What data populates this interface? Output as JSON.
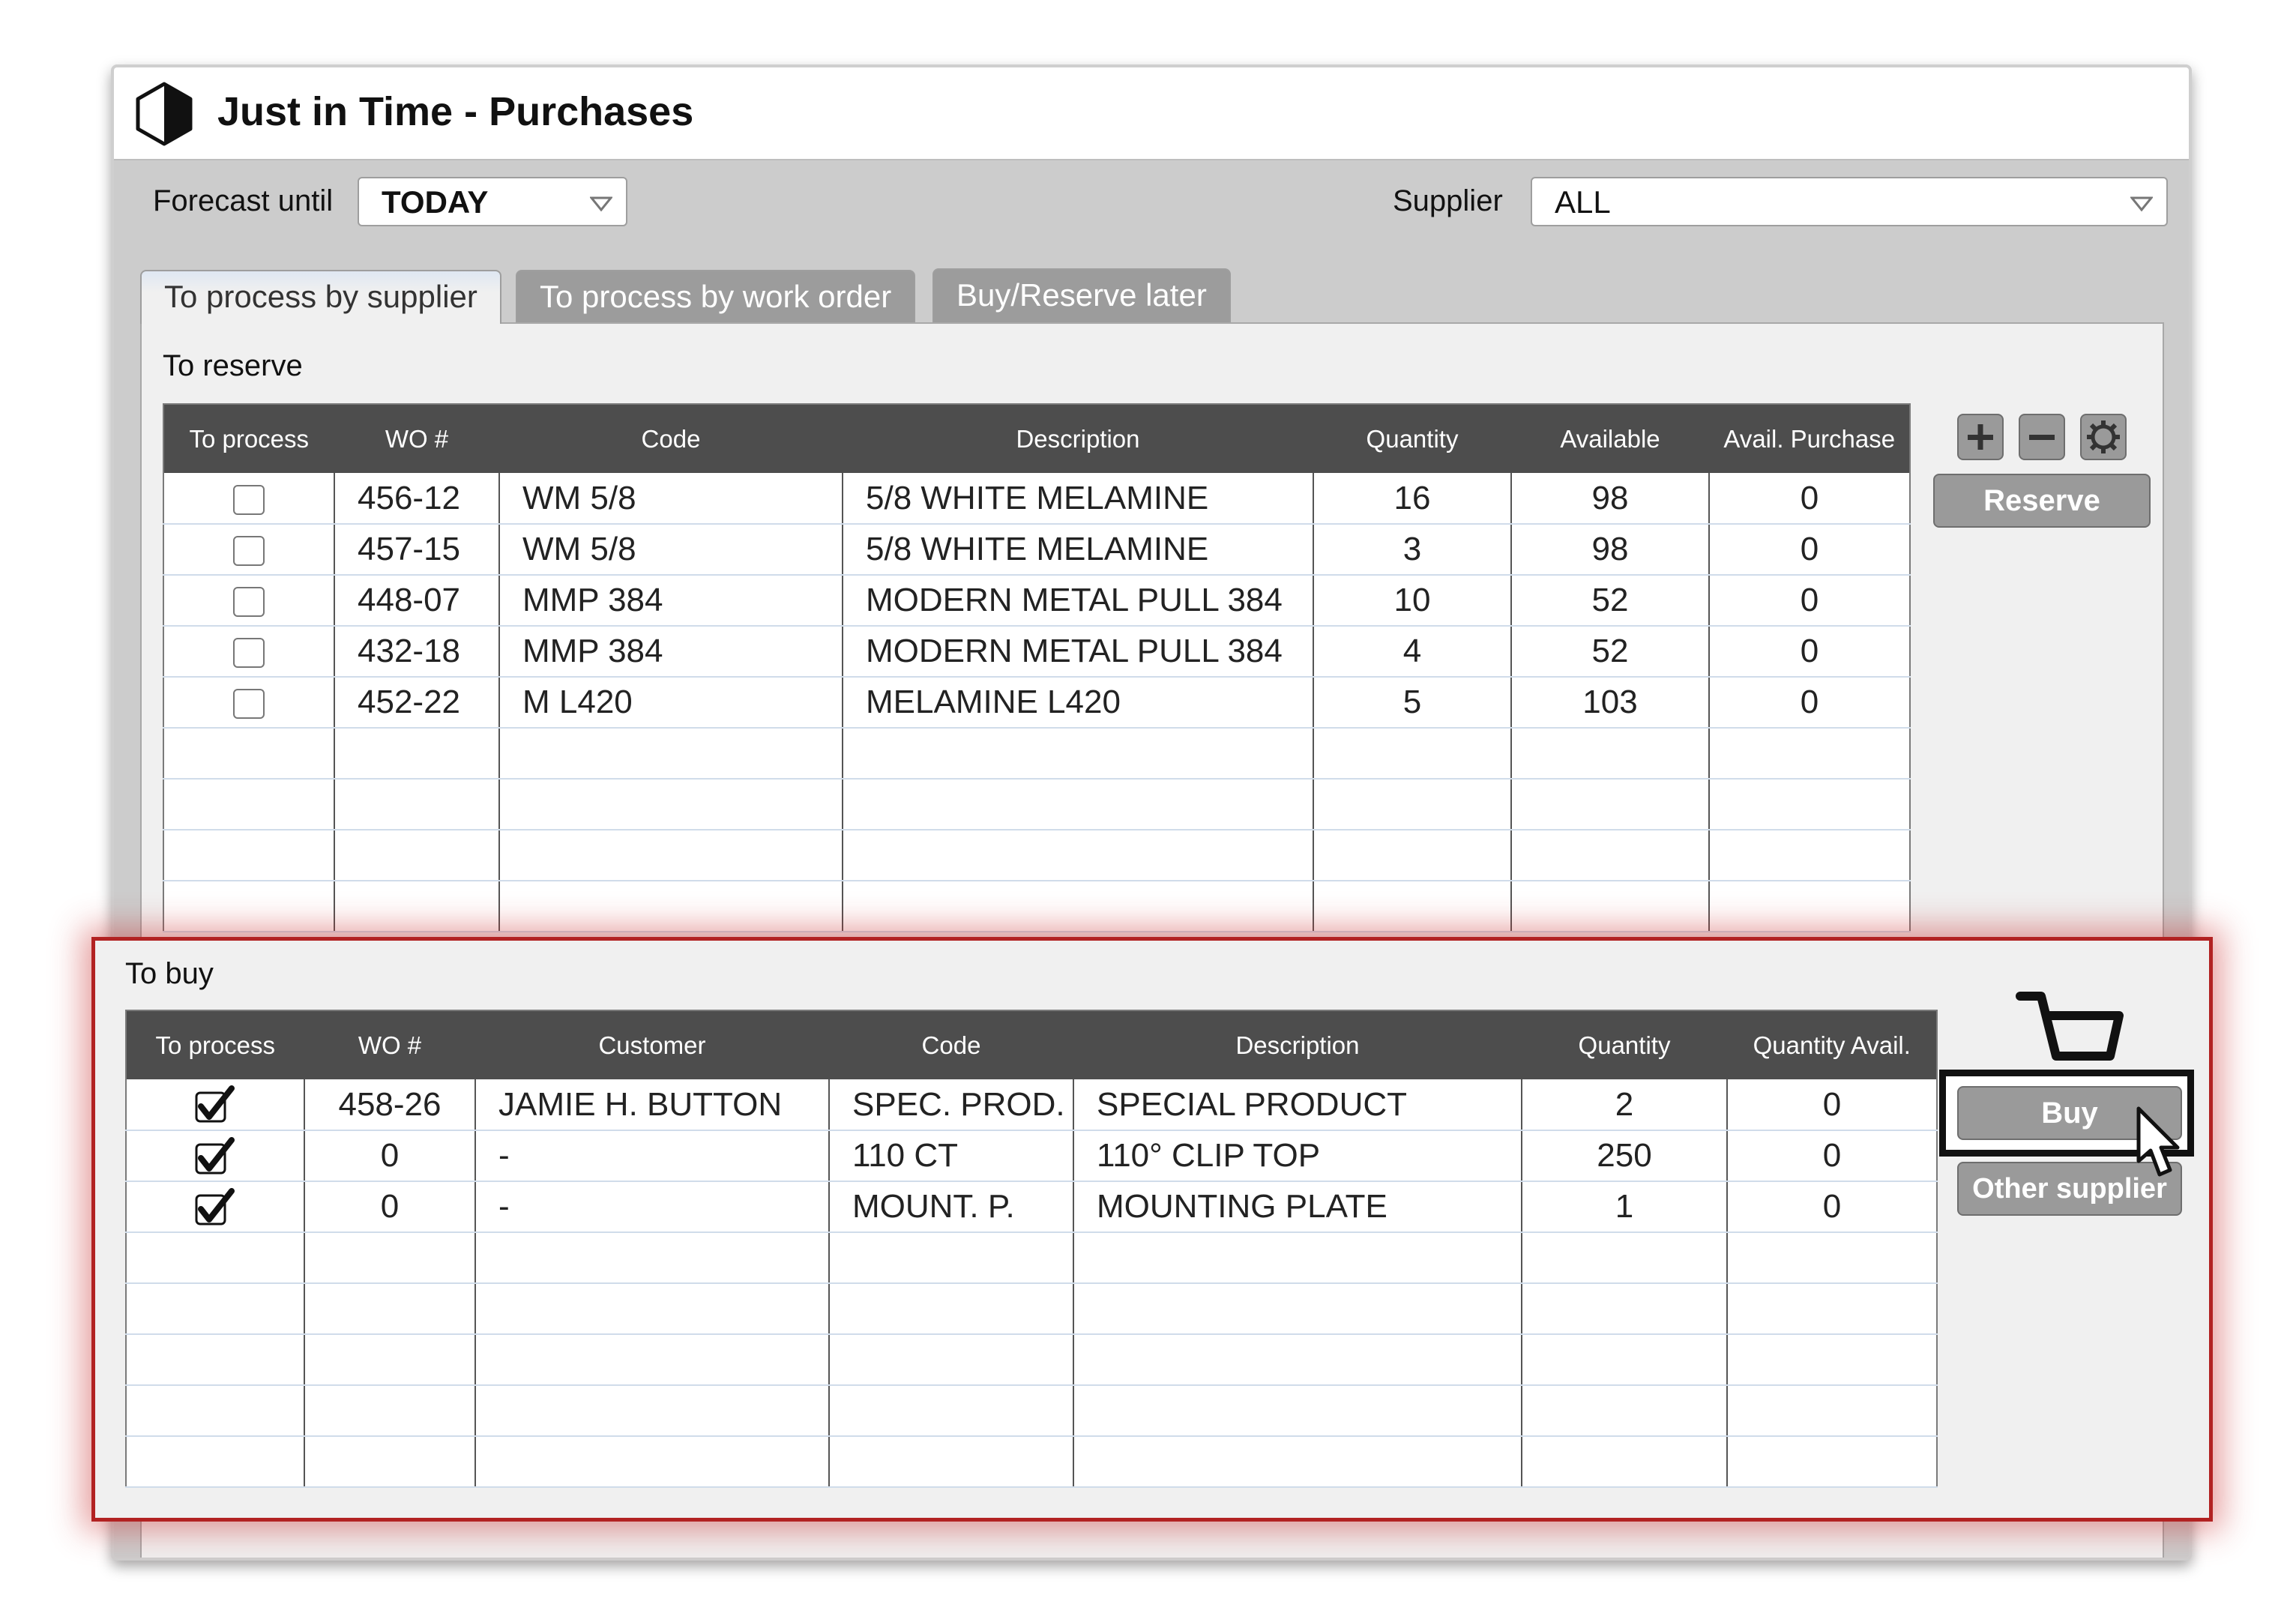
{
  "window": {
    "title": "Just in Time - Purchases"
  },
  "filters": {
    "forecast_label": "Forecast until",
    "forecast_value": "TODAY",
    "supplier_label": "Supplier",
    "supplier_value": "ALL"
  },
  "tabs": [
    {
      "label": "To process by supplier",
      "active": true
    },
    {
      "label": "To process by work order",
      "active": false
    },
    {
      "label": "Buy/Reserve later",
      "active": false
    }
  ],
  "reserve": {
    "section_label": "To reserve",
    "columns": [
      "To process",
      "WO #",
      "Code",
      "Description",
      "Quantity",
      "Available",
      "Avail. Purchase"
    ],
    "rows": [
      {
        "checked": false,
        "wo": "456-12",
        "code": "WM 5/8",
        "description": "5/8 WHITE MELAMINE",
        "quantity": "16",
        "available": "98",
        "avail_purchase": "0"
      },
      {
        "checked": false,
        "wo": "457-15",
        "code": "WM 5/8",
        "description": "5/8 WHITE MELAMINE",
        "quantity": "3",
        "available": "98",
        "avail_purchase": "0"
      },
      {
        "checked": false,
        "wo": "448-07",
        "code": "MMP 384",
        "description": "MODERN METAL PULL 384",
        "quantity": "10",
        "available": "52",
        "avail_purchase": "0"
      },
      {
        "checked": false,
        "wo": "432-18",
        "code": "MMP 384",
        "description": "MODERN METAL PULL 384",
        "quantity": "4",
        "available": "52",
        "avail_purchase": "0"
      },
      {
        "checked": false,
        "wo": "452-22",
        "code": "M L420",
        "description": "MELAMINE L420",
        "quantity": "5",
        "available": "103",
        "avail_purchase": "0"
      }
    ],
    "reserve_button": "Reserve",
    "icons": [
      "plus-icon",
      "minus-icon",
      "gear-icon"
    ]
  },
  "buy": {
    "section_label": "To buy",
    "columns": [
      "To process",
      "WO #",
      "Customer",
      "Code",
      "Description",
      "Quantity",
      "Quantity Avail."
    ],
    "rows": [
      {
        "checked": true,
        "wo": "458-26",
        "customer": "JAMIE H. BUTTON",
        "code": "SPEC. PROD.",
        "description": "SPECIAL PRODUCT",
        "quantity": "2",
        "quantity_avail": "0"
      },
      {
        "checked": true,
        "wo": "0",
        "customer": "-",
        "code": "110 CT",
        "description": "110° CLIP TOP",
        "quantity": "250",
        "quantity_avail": "0"
      },
      {
        "checked": true,
        "wo": "0",
        "customer": "-",
        "code": "MOUNT. P.",
        "description": "MOUNTING PLATE",
        "quantity": "1",
        "quantity_avail": "0"
      }
    ],
    "buy_button": "Buy",
    "other_supplier_button": "Other supplier",
    "icons": [
      "shopping-cart-icon",
      "cursor-arrow-icon"
    ]
  },
  "colors": {
    "highlight_border": "#b22222",
    "header_bg": "#4d4d4d",
    "button_bg": "#9a9a9a"
  }
}
